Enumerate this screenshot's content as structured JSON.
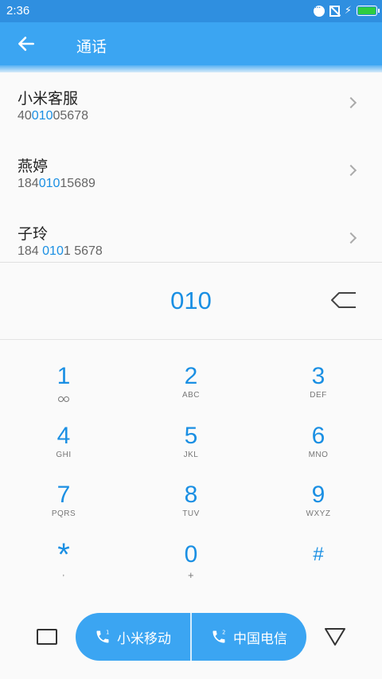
{
  "status_bar": {
    "time": "2:36",
    "icons": [
      "more-dots-icon",
      "no-sim-icon",
      "charging-bolt-icon",
      "battery-icon"
    ]
  },
  "app_bar": {
    "title": "通话",
    "back_icon": "arrow-left-icon"
  },
  "contacts": [
    {
      "name": "小米客服",
      "number_pre": "40",
      "number_match": "010",
      "number_post": "05678"
    },
    {
      "name": "燕婷",
      "number_pre": "184",
      "number_match": "010",
      "number_post": "15689"
    },
    {
      "name": "子玲",
      "number_pre": "184 ",
      "number_match": "010",
      "number_post": "1 5678"
    }
  ],
  "dialer": {
    "dialed_number": "010",
    "backspace_icon": "backspace-icon"
  },
  "keypad": [
    {
      "digit": "1",
      "letters": ""
    },
    {
      "digit": "2",
      "letters": "ABC"
    },
    {
      "digit": "3",
      "letters": "DEF"
    },
    {
      "digit": "4",
      "letters": "GHI"
    },
    {
      "digit": "5",
      "letters": "JKL"
    },
    {
      "digit": "6",
      "letters": "MNO"
    },
    {
      "digit": "7",
      "letters": "PQRS"
    },
    {
      "digit": "8",
      "letters": "TUV"
    },
    {
      "digit": "9",
      "letters": "WXYZ"
    },
    {
      "digit": "*",
      "letters": ","
    },
    {
      "digit": "0",
      "letters": "+"
    },
    {
      "digit": "#",
      "letters": ""
    }
  ],
  "bottom_bar": {
    "sim1_label": "小米移动",
    "sim1_index": "1",
    "sim2_label": "中国电信",
    "sim2_index": "2"
  },
  "colors": {
    "accent": "#1a8fe3",
    "app_bar": "#3ba5f2",
    "status_bar": "#2f8fe0"
  }
}
